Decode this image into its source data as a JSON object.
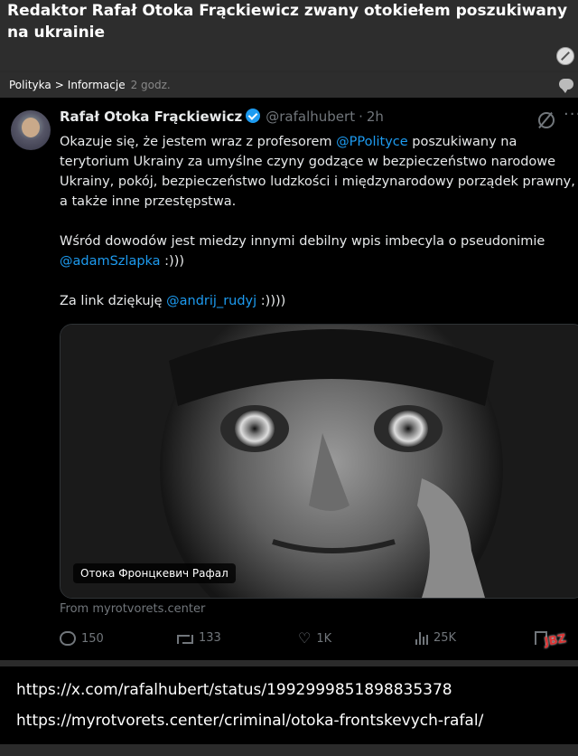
{
  "post": {
    "title": "Redaktor Rafał Otoka Frąckiewicz zwany otokiełem poszukiwany na ukrainie",
    "category": "Polityka",
    "separator": ">",
    "subcategory": "Informacje",
    "time_ago": "2 godz."
  },
  "tweet": {
    "author_name": "Rafał Otoka Frąckiewicz",
    "handle": "@rafalhubert",
    "dot": "·",
    "time": "2h",
    "more": "···",
    "para1_a": "Okazuje się, że jestem wraz z profesorem ",
    "para1_mention": "@PPolityce",
    "para1_b": " poszukiwany na terytorium Ukrainy za umyślne czyny godzące w bezpieczeństwo narodowe Ukrainy, pokój, bezpieczeństwo ludzkości i międzynarodowy porządek prawny, a także inne przestępstwa.",
    "para2_a": "Wśród dowodów jest miedzy innymi debilny wpis imbecyla o pseudonimie ",
    "para2_mention": "@adamSzlapka",
    "para2_b": " :)))",
    "para3_a": "Za link dziękuję ",
    "para3_mention": "@andrij_rudyj",
    "para3_b": " :))))",
    "media_caption": "Отока Фронцкевич Рафал",
    "media_source": "From myrotvorets.center",
    "replies": "150",
    "retweets": "133",
    "likes": "1K",
    "views": "25K",
    "accent_color": "#1d9bf0"
  },
  "watermark": "JBZ",
  "links": {
    "tweet_url": "https://x.com/rafalhubert/status/1992999851898835378",
    "source_url": "https://myrotvorets.center/criminal/otoka-frontskevych-rafal/"
  }
}
